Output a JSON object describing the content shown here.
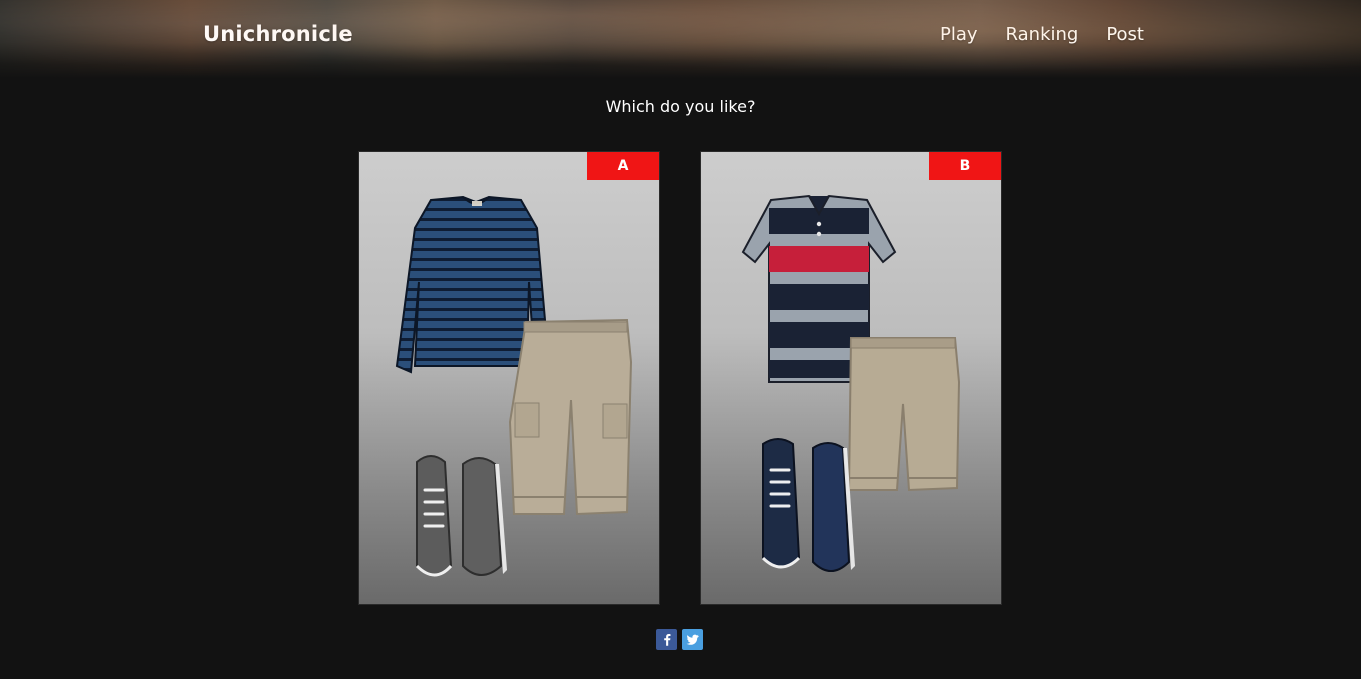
{
  "header": {
    "brand": "Unichronicle",
    "nav": [
      "Play",
      "Ranking",
      "Post"
    ]
  },
  "main": {
    "question": "Which do you like?",
    "options": [
      {
        "label": "A",
        "items": [
          "striped-long-sleeve-tee-icon",
          "cargo-shorts-icon",
          "canvas-sneakers-icon"
        ]
      },
      {
        "label": "B",
        "items": [
          "striped-polo-icon",
          "chino-shorts-icon",
          "canvas-sneakers-icon"
        ]
      }
    ]
  },
  "colors": {
    "badge": "#f01515",
    "background": "#121212",
    "facebook": "#3b5998",
    "twitter": "#4a9fe0"
  },
  "social": [
    "facebook-icon",
    "twitter-icon"
  ]
}
